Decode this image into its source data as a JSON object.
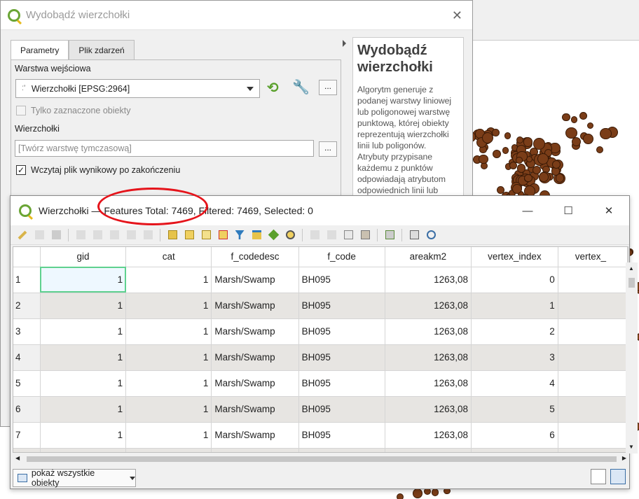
{
  "colors": {
    "annotation_ellipse": "#e5141b",
    "map_feature": "#7a3d18",
    "selected_cell": "#5fd18f",
    "qgis_green": "#6aa535"
  },
  "processing_dialog": {
    "title": "Wydobądź wierzchołki",
    "close_icon": "close-icon",
    "tabs": [
      "Parametry",
      "Plik zdarzeń"
    ],
    "input_layer_label": "Warstwa wejściowa",
    "input_layer_value": "Wierzchołki [EPSG:2964]",
    "selected_only_label": "Tylko zaznaczone obiekty",
    "selected_only_checked": false,
    "output_label": "Wierzchołki",
    "output_placeholder": "[Twórz warstwę tymczasową]",
    "open_output_label": "Wczytaj plik wynikowy po zakończeniu",
    "open_output_checked": true,
    "ellipsis_label": "...",
    "help_title": "Wydobądź wierzchołki",
    "help_text": "Algorytm generuje z podanej warstwy liniowej lub poligonowej warstwę punktową, której obiekty reprezentują wierzchołki linii lub poligonów. Atrybuty przypisane każdemu z punktów odpowiadają atrybutom odpowiednich linii lub"
  },
  "attribute_table": {
    "title": "Wierzchołki — Features Total: 7469, Filtered: 7469, Selected: 0",
    "columns": [
      "gid",
      "cat",
      "f_codedesc",
      "f_code",
      "areakm2",
      "vertex_index",
      "vertex_"
    ],
    "rows": [
      {
        "n": "1",
        "gid": "1",
        "cat": "1",
        "f_codedesc": "Marsh/Swamp",
        "f_code": "BH095",
        "areakm2": "1263,08",
        "vertex_index": "0"
      },
      {
        "n": "2",
        "gid": "1",
        "cat": "1",
        "f_codedesc": "Marsh/Swamp",
        "f_code": "BH095",
        "areakm2": "1263,08",
        "vertex_index": "1"
      },
      {
        "n": "3",
        "gid": "1",
        "cat": "1",
        "f_codedesc": "Marsh/Swamp",
        "f_code": "BH095",
        "areakm2": "1263,08",
        "vertex_index": "2"
      },
      {
        "n": "4",
        "gid": "1",
        "cat": "1",
        "f_codedesc": "Marsh/Swamp",
        "f_code": "BH095",
        "areakm2": "1263,08",
        "vertex_index": "3"
      },
      {
        "n": "5",
        "gid": "1",
        "cat": "1",
        "f_codedesc": "Marsh/Swamp",
        "f_code": "BH095",
        "areakm2": "1263,08",
        "vertex_index": "4"
      },
      {
        "n": "6",
        "gid": "1",
        "cat": "1",
        "f_codedesc": "Marsh/Swamp",
        "f_code": "BH095",
        "areakm2": "1263,08",
        "vertex_index": "5"
      },
      {
        "n": "7",
        "gid": "1",
        "cat": "1",
        "f_codedesc": "Marsh/Swamp",
        "f_code": "BH095",
        "areakm2": "1263,08",
        "vertex_index": "6"
      }
    ],
    "show_all_label": "pokaż wszystkie obiekty",
    "window_buttons": {
      "minimize": "—",
      "maximize": "☐",
      "close": "✕"
    }
  }
}
